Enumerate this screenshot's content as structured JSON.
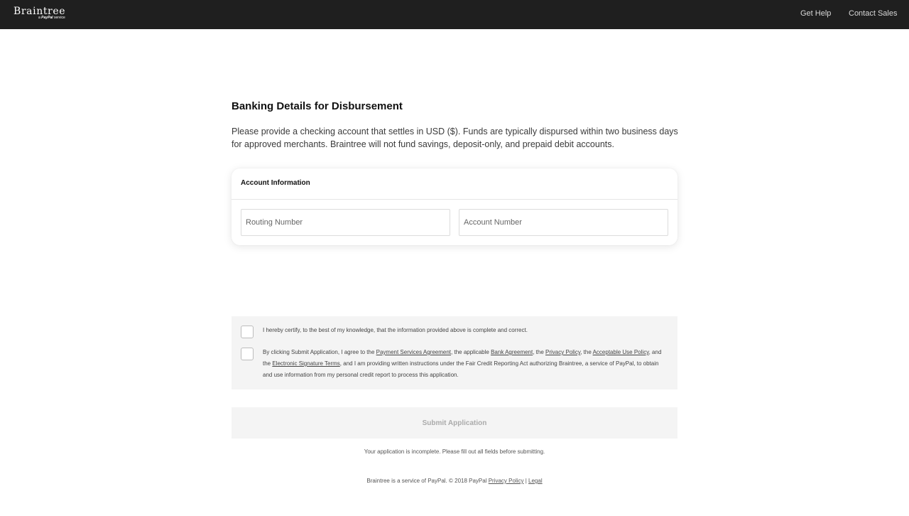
{
  "header": {
    "logo_brand": "Braintree",
    "logo_sub_prefix": "a",
    "logo_sub_brand": "PayPal",
    "logo_sub_suffix": "service",
    "nav_get_help": "Get Help",
    "nav_contact_sales": "Contact Sales"
  },
  "main": {
    "title": "Banking Details for Disbursement",
    "intro": "Please provide a checking account that settles in USD ($). Funds are typically dispursed within two business days for approved merchants. Braintree will not fund savings, deposit-only, and prepaid debit accounts."
  },
  "card": {
    "heading": "Account Information",
    "routing_placeholder": "Routing Number",
    "routing_value": "",
    "account_placeholder": "Account Number",
    "account_value": ""
  },
  "consent": {
    "certify_checked": false,
    "agree_checked": false,
    "certify_text": "I hereby certify, to the best of my knowledge, that the information provided above is complete and correct.",
    "agree": {
      "t1": "By clicking Submit Application, I agree to the ",
      "link_psa": "Payment Services Agreement",
      "t2": ", the applicable ",
      "link_bank": "Bank Agreement",
      "t3": ", the ",
      "link_privacy": "Privacy Policy",
      "t4": ", the ",
      "link_aup": "Acceptable Use Policy",
      "t5": ", and the ",
      "link_est": "Electronic Signature Terms",
      "t6": ", and I am providing written instructions under the Fair Credit Reporting Act authorizing Braintree, a service of PayPal, to obtain and use information from my personal credit report to process this application."
    }
  },
  "submit": {
    "label": "Submit Application",
    "status": "Your application is incomplete. Please fill out all fields before submitting."
  },
  "footer": {
    "text": "Braintree is a service of PayPal. © 2018 PayPal ",
    "privacy_link": "Privacy Policy",
    "separator": " | ",
    "legal_link": "Legal"
  },
  "colors": {
    "topbar": "#1f1f1f",
    "panel_bg": "#f4f4f4",
    "disabled_text": "#aaaaaa"
  }
}
